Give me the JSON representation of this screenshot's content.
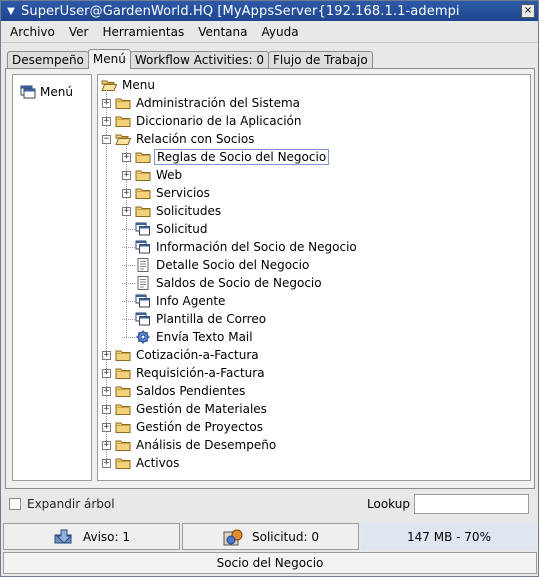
{
  "window": {
    "title": "SuperUser@GardenWorld.HQ [MyAppsServer{192.168.1.1-adempi",
    "close_glyph": "×"
  },
  "menubar": [
    "Archivo",
    "Ver",
    "Herramientas",
    "Ventana",
    "Ayuda"
  ],
  "tabs": [
    {
      "label": "Desempeño",
      "active": false
    },
    {
      "label": "Menú",
      "active": true
    },
    {
      "label": "Workflow Activities: 0",
      "active": false
    },
    {
      "label": "Flujo de Trabajo",
      "active": false
    }
  ],
  "left_panel": {
    "item": "Menú"
  },
  "tree": {
    "root": "Menu",
    "items": [
      {
        "label": "Administración del Sistema",
        "level": 1,
        "type": "folder",
        "state": "collapsed"
      },
      {
        "label": "Diccionario de la Aplicación",
        "level": 1,
        "type": "folder",
        "state": "collapsed"
      },
      {
        "label": "Relación con Socios",
        "level": 1,
        "type": "folder-open",
        "state": "expanded"
      },
      {
        "label": "Reglas de Socio del Negocio",
        "level": 2,
        "type": "folder",
        "state": "collapsed",
        "selected": true
      },
      {
        "label": "Web",
        "level": 2,
        "type": "folder",
        "state": "collapsed"
      },
      {
        "label": "Servicios",
        "level": 2,
        "type": "folder",
        "state": "collapsed"
      },
      {
        "label": "Solicitudes",
        "level": 2,
        "type": "folder",
        "state": "collapsed"
      },
      {
        "label": "Solicitud",
        "level": 2,
        "type": "window"
      },
      {
        "label": "Información del Socio de Negocio",
        "level": 2,
        "type": "window"
      },
      {
        "label": "Detalle Socio del Negocio",
        "level": 2,
        "type": "report"
      },
      {
        "label": "Saldos de Socio de Negocio",
        "level": 2,
        "type": "report"
      },
      {
        "label": "Info Agente",
        "level": 2,
        "type": "window"
      },
      {
        "label": "Plantilla de Correo",
        "level": 2,
        "type": "window"
      },
      {
        "label": "Envía Texto Mail",
        "level": 2,
        "type": "process"
      },
      {
        "label": "Cotización-a-Factura",
        "level": 1,
        "type": "folder",
        "state": "collapsed"
      },
      {
        "label": "Requisición-a-Factura",
        "level": 1,
        "type": "folder",
        "state": "collapsed"
      },
      {
        "label": "Saldos Pendientes",
        "level": 1,
        "type": "folder",
        "state": "collapsed"
      },
      {
        "label": "Gestión de Materiales",
        "level": 1,
        "type": "folder",
        "state": "collapsed"
      },
      {
        "label": "Gestión de Proyectos",
        "level": 1,
        "type": "folder",
        "state": "collapsed"
      },
      {
        "label": "Análisis de Desempeño",
        "level": 1,
        "type": "folder",
        "state": "collapsed"
      },
      {
        "label": "Activos",
        "level": 1,
        "type": "folder",
        "state": "collapsed"
      }
    ]
  },
  "bottom": {
    "expand_label": "Expandir árbol",
    "expand_checked": false,
    "lookup_label": "Lookup",
    "lookup_value": ""
  },
  "status": {
    "aviso": "Aviso: 1",
    "solicitud": "Solicitud: 0",
    "memory": "147 MB - 70%"
  },
  "footer": "Socio del Negocio"
}
